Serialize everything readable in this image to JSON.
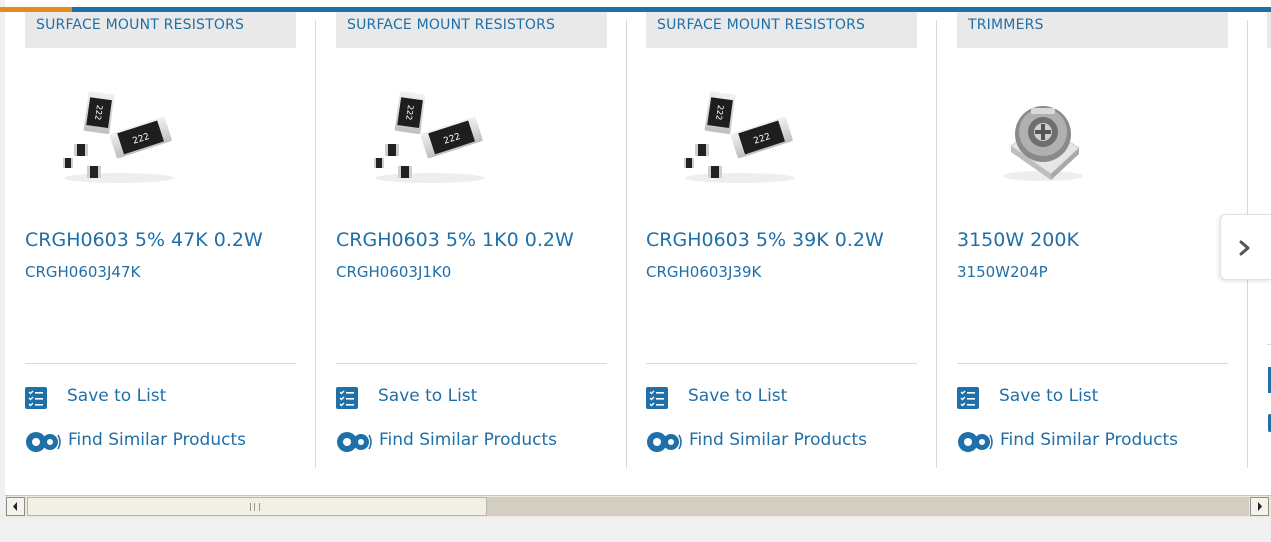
{
  "carousel": {
    "cards": [
      {
        "category": "SURFACE MOUNT RESISTORS",
        "title": "CRGH0603 5% 47K 0.2W",
        "part_number": "CRGH0603J47K",
        "image": "smd-resistor-chips-image"
      },
      {
        "category": "SURFACE MOUNT RESISTORS",
        "title": "CRGH0603 5% 1K0 0.2W",
        "part_number": "CRGH0603J1K0",
        "image": "smd-resistor-chips-image"
      },
      {
        "category": "SURFACE MOUNT RESISTORS",
        "title": "CRGH0603 5% 39K 0.2W",
        "part_number": "CRGH0603J39K",
        "image": "smd-resistor-chips-image"
      },
      {
        "category": "TRIMMERS",
        "title": "3150W 200K",
        "part_number": "3150W204P",
        "image": "trimmer-potentiometer-image"
      }
    ],
    "actions": {
      "save_label": "Save to List",
      "similar_label": "Find Similar Products"
    },
    "next_icon": "chevron-right-icon",
    "chip_marking": "222"
  },
  "colors": {
    "link": "#1f6fa8",
    "tag_bg": "#e9e9e9",
    "accent": "#e58a1f"
  },
  "scrollbar": {
    "orientation": "horizontal"
  }
}
